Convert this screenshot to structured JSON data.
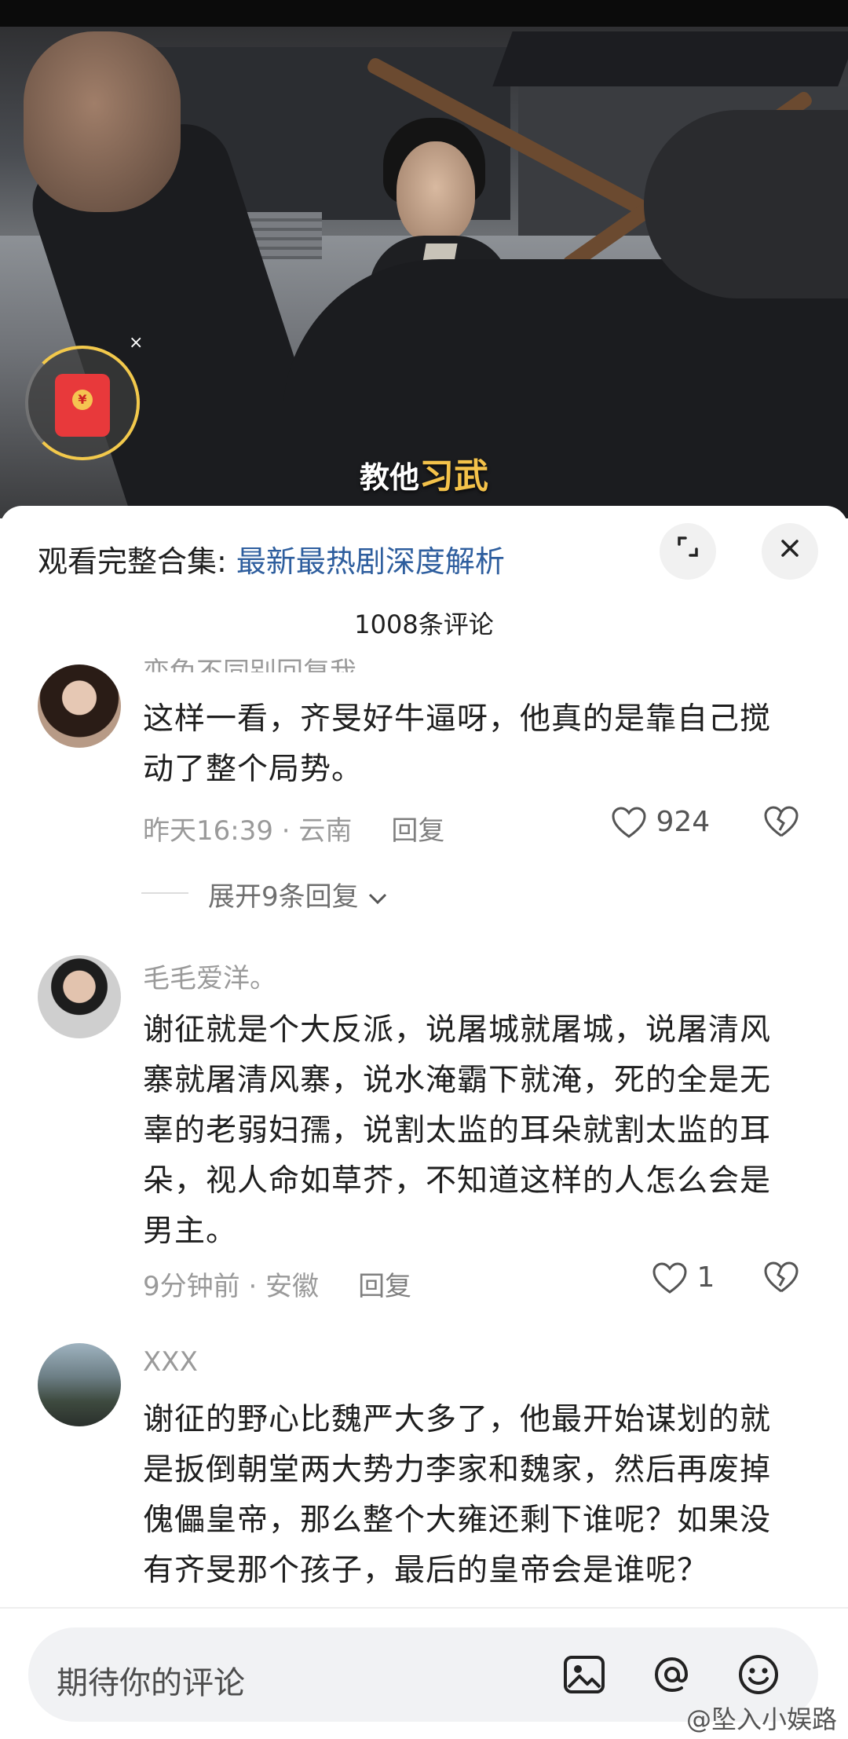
{
  "video": {
    "subtitle_prefix": "教他",
    "subtitle_highlight": "习武",
    "redpacket_close": "×",
    "redpacket_symbol": "¥"
  },
  "sheet": {
    "header_prefix": "观看完整合集: ",
    "header_link": "最新最热剧深度解析",
    "expand_icon": "expand-icon",
    "close_icon": "close-icon",
    "comment_count": "1008条评论"
  },
  "comments": [
    {
      "username": "恋兔不同别回复我",
      "text": "这样一看，齐旻好牛逼呀，他真的是靠自己搅动了整个局势。",
      "time_location": "昨天16:39 · 云南",
      "reply": "回复",
      "likes": "924",
      "expand_replies": "展开9条回复"
    },
    {
      "username": "毛毛爱洋。",
      "text": "谢征就是个大反派，说屠城就屠城，说屠清风寨就屠清风寨，说水淹霸下就淹，死的全是无辜的老弱妇孺，说割太监的耳朵就割太监的耳朵，视人命如草芥，不知道这样的人怎么会是男主。",
      "time_location": "9分钟前 · 安徽",
      "reply": "回复",
      "likes": "1"
    },
    {
      "username": "XXX",
      "text": "谢征的野心比魏严大多了，他最开始谋划的就是扳倒朝堂两大势力李家和魏家，然后再废掉傀儡皇帝，那么整个大雍还剩下谁呢？如果没有齐旻那个孩子，最后的皇帝会是谁呢？"
    }
  ],
  "input": {
    "placeholder": "期待你的评论",
    "icons": [
      "image-icon",
      "at-icon",
      "emoji-icon"
    ]
  },
  "watermark": "@坠入小娱路"
}
